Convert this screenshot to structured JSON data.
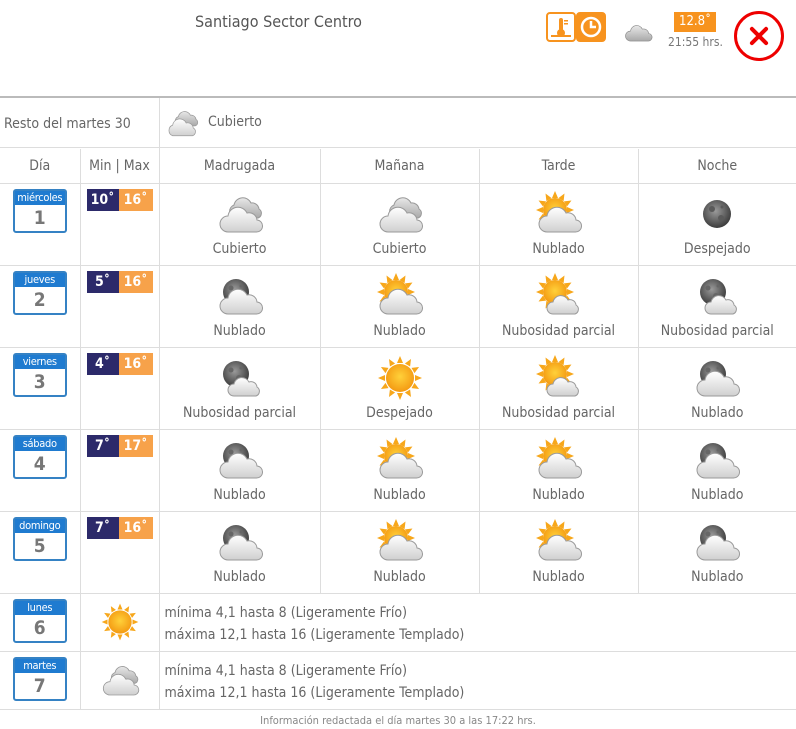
{
  "header": {
    "city": "Santiago Sector Centro",
    "current_temp": "12.8˚",
    "time": "21:55 hrs.",
    "current_icon": "cloud-icon"
  },
  "resto": {
    "label": "Resto del martes 30",
    "condition": "Cubierto",
    "icon": "overcast-icon"
  },
  "table": {
    "headers": [
      "Día",
      "Min | Max",
      "Madrugada",
      "Mañana",
      "Tarde",
      "Noche"
    ],
    "days": [
      {
        "name": "miércoles",
        "num": "1",
        "min": "10˚",
        "max": "16˚",
        "periods": [
          {
            "icon": "overcast",
            "label": "Cubierto"
          },
          {
            "icon": "overcast",
            "label": "Cubierto"
          },
          {
            "icon": "sun-cloud",
            "label": "Nublado"
          },
          {
            "icon": "moon",
            "label": "Despejado"
          }
        ]
      },
      {
        "name": "jueves",
        "num": "2",
        "min": "5˚",
        "max": "16˚",
        "periods": [
          {
            "icon": "moon-cloud",
            "label": "Nublado"
          },
          {
            "icon": "sun-cloud",
            "label": "Nublado"
          },
          {
            "icon": "sun-cloud-small",
            "label": "Nubosidad parcial"
          },
          {
            "icon": "moon-cloud-small",
            "label": "Nubosidad parcial"
          }
        ]
      },
      {
        "name": "viernes",
        "num": "3",
        "min": "4˚",
        "max": "16˚",
        "periods": [
          {
            "icon": "moon-cloud-small",
            "label": "Nubosidad parcial"
          },
          {
            "icon": "sun",
            "label": "Despejado"
          },
          {
            "icon": "sun-cloud-small",
            "label": "Nubosidad parcial"
          },
          {
            "icon": "moon-cloud",
            "label": "Nublado"
          }
        ]
      },
      {
        "name": "sábado",
        "num": "4",
        "min": "7˚",
        "max": "17˚",
        "periods": [
          {
            "icon": "moon-cloud",
            "label": "Nublado"
          },
          {
            "icon": "sun-cloud",
            "label": "Nublado"
          },
          {
            "icon": "sun-cloud",
            "label": "Nublado"
          },
          {
            "icon": "moon-cloud",
            "label": "Nublado"
          }
        ]
      },
      {
        "name": "domingo",
        "num": "5",
        "min": "7˚",
        "max": "16˚",
        "periods": [
          {
            "icon": "moon-cloud",
            "label": "Nublado"
          },
          {
            "icon": "sun-cloud",
            "label": "Nublado"
          },
          {
            "icon": "sun-cloud",
            "label": "Nublado"
          },
          {
            "icon": "moon-cloud",
            "label": "Nublado"
          }
        ]
      }
    ],
    "extended": [
      {
        "name": "lunes",
        "num": "6",
        "icon": "sun",
        "line1": "mínima 4,1 hasta 8 (Ligeramente Frío)",
        "line2": "máxima 12,1 hasta 16 (Ligeramente Templado)"
      },
      {
        "name": "martes",
        "num": "7",
        "icon": "overcast",
        "line1": "mínima 4,1 hasta 8 (Ligeramente Frío)",
        "line2": "máxima 12,1 hasta 16 (Ligeramente Templado)"
      }
    ]
  },
  "footer": "Información redactada el día martes 30 a las 17:22 hrs.",
  "colors": {
    "accent": "#f7931e",
    "min_bg": "#2c2a6a",
    "max_bg": "#f7a24a",
    "day_blue": "#1f7bd0",
    "close_red": "#ee0000"
  }
}
